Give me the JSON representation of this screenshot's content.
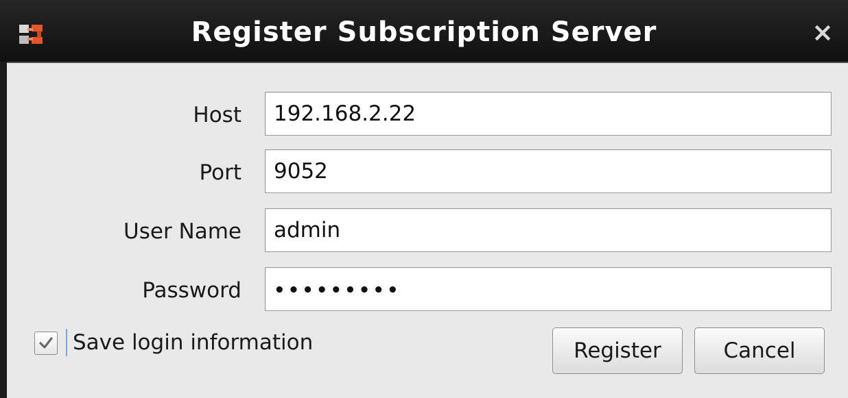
{
  "window": {
    "title": "Register Subscription Server",
    "close_label": "×",
    "app_icon": "app-logo-icon"
  },
  "form": {
    "host": {
      "label": "Host",
      "value": "192.168.2.22"
    },
    "port": {
      "label": "Port",
      "value": "9052"
    },
    "username": {
      "label": "User Name",
      "value": "admin"
    },
    "password": {
      "label": "Password",
      "value": "•••••••••"
    },
    "save_login": {
      "label": "Save login information",
      "checked": true
    }
  },
  "buttons": {
    "register": "Register",
    "cancel": "Cancel"
  },
  "colors": {
    "titlebar": "#1c1c1c",
    "body": "#e9e9e9",
    "accent": "#e2572a"
  }
}
